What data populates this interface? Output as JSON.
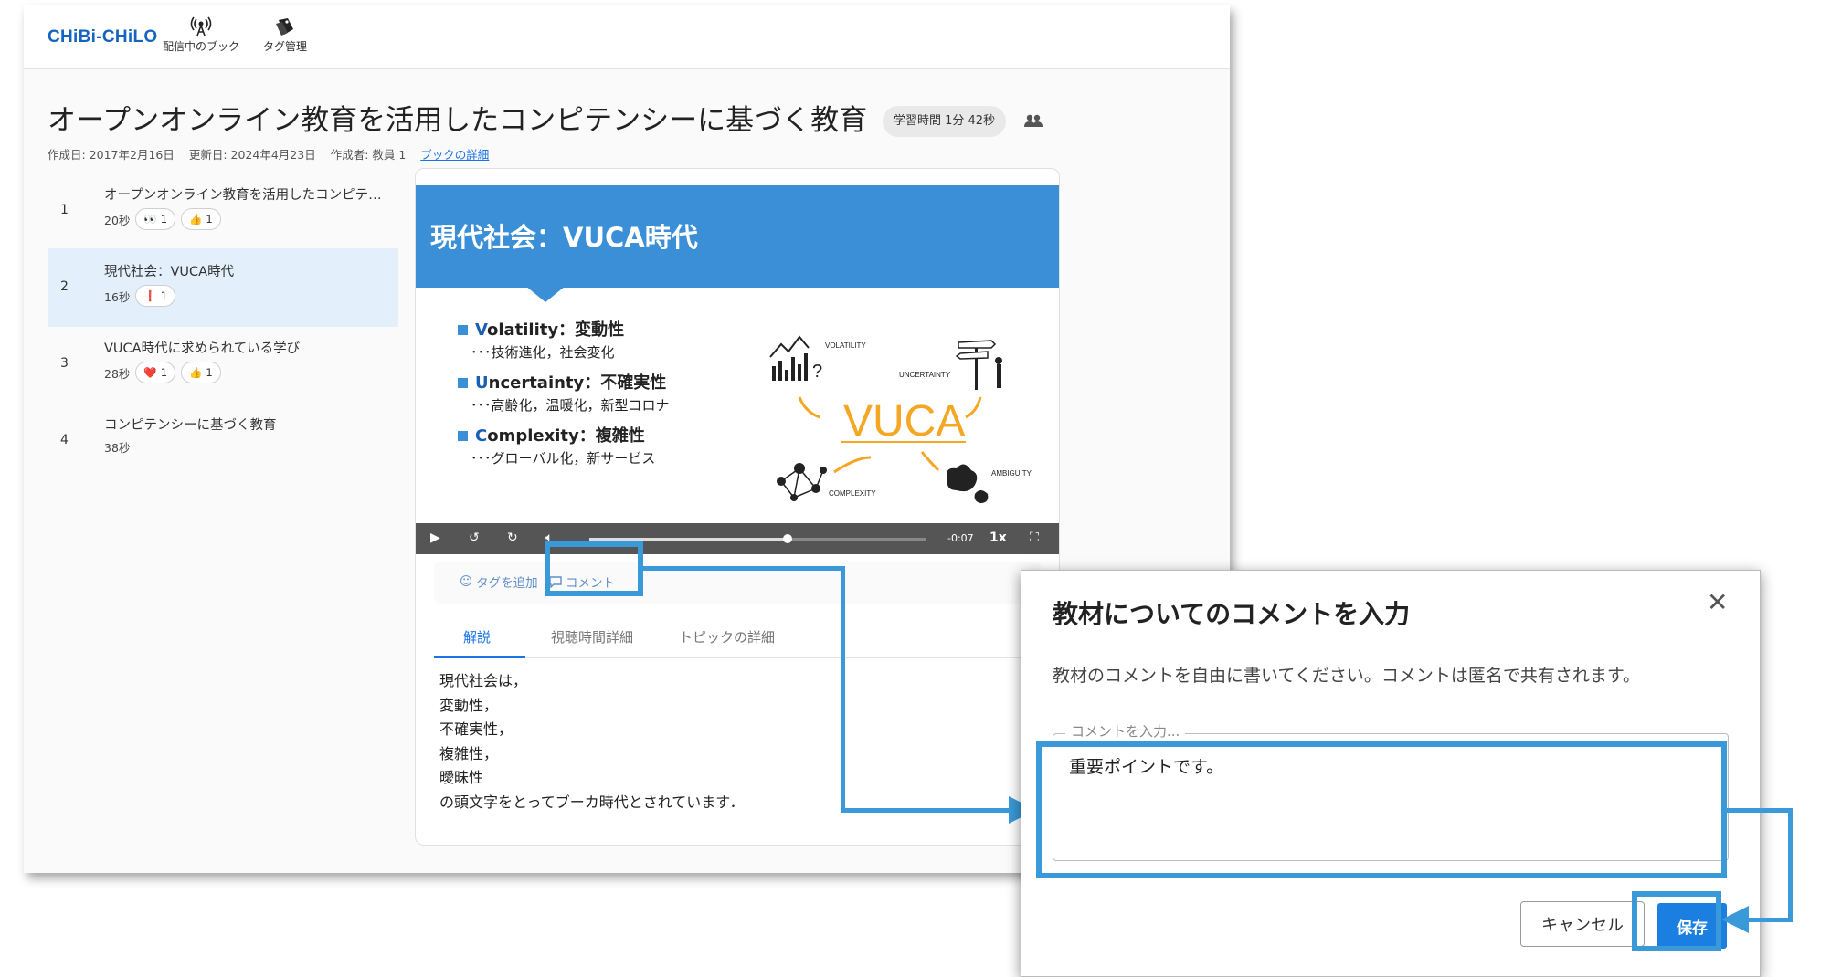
{
  "app": {
    "logo": "CHiBi-CHiLO",
    "nav": [
      {
        "label": "配信中のブック",
        "icon": "broadcast-icon"
      },
      {
        "label": "タグ管理",
        "icon": "tag-icon"
      }
    ]
  },
  "book": {
    "title": "オープンオンライン教育を活用したコンピテンシーに基づく教育",
    "time_chip": "学習時間 1分 42秒",
    "meta": {
      "created": "作成日: 2017年2月16日",
      "updated": "更新日: 2024年4月23日",
      "author": "作成者: 教員 1",
      "details_link": "ブックの詳細"
    }
  },
  "topics": [
    {
      "num": "1",
      "title": "オープンオンライン教育を活用したコンピテ…",
      "duration": "20秒",
      "reactions": [
        {
          "emoji": "👀",
          "count": "1"
        },
        {
          "emoji": "👍",
          "count": "1"
        }
      ]
    },
    {
      "num": "2",
      "title": "現代社会：VUCA時代",
      "duration": "16秒",
      "reactions": [
        {
          "emoji": "❗",
          "count": "1"
        }
      ]
    },
    {
      "num": "3",
      "title": "VUCA時代に求められている学び",
      "duration": "28秒",
      "reactions": [
        {
          "emoji": "❤️",
          "count": "1"
        },
        {
          "emoji": "👍",
          "count": "1"
        }
      ]
    },
    {
      "num": "4",
      "title": "コンピテンシーに基づく教育",
      "duration": "38秒",
      "reactions": []
    }
  ],
  "slide": {
    "heading": "現代社会：VUCA時代",
    "bullets": [
      {
        "cap": "V",
        "rest": "olatility：変動性",
        "sub": "･･･技術進化，社会変化"
      },
      {
        "cap": "U",
        "rest": "ncertainty：不確実性",
        "sub": "･･･高齢化，温暖化，新型コロナ"
      },
      {
        "cap": "C",
        "rest": "omplexity：複雑性",
        "sub": "･･･グローバル化，新サービス"
      }
    ],
    "art": {
      "word": "VUCA",
      "volatility": "VOLATILITY",
      "uncertainty": "UNCERTAINTY",
      "complexity": "COMPLEXITY",
      "ambiguity": "AMBIGUITY",
      "question": "?"
    }
  },
  "player": {
    "time_left": "-0:07",
    "speed": "1x",
    "progress": 0.59
  },
  "actions": {
    "add_tag": "タグを追加",
    "comment": "コメント"
  },
  "tabs": [
    "解説",
    "視聴時間詳細",
    "トピックの詳細"
  ],
  "description": "現代社会は，\n変動性，\n不確実性，\n複雑性，\n曖昧性\nの頭文字をとってブーカ時代とされています．",
  "dialog": {
    "title": "教材についてのコメントを入力",
    "text": "教材のコメントを自由に書いてください。コメントは匿名で共有されます。",
    "field_label": "コメントを入力...",
    "field_value": "重要ポイントです。",
    "cancel": "キャンセル",
    "save": "保存"
  },
  "colors": {
    "accent": "#3a9ad9",
    "primary": "#1a7fe0",
    "slide_blue": "#3b8fd7"
  }
}
